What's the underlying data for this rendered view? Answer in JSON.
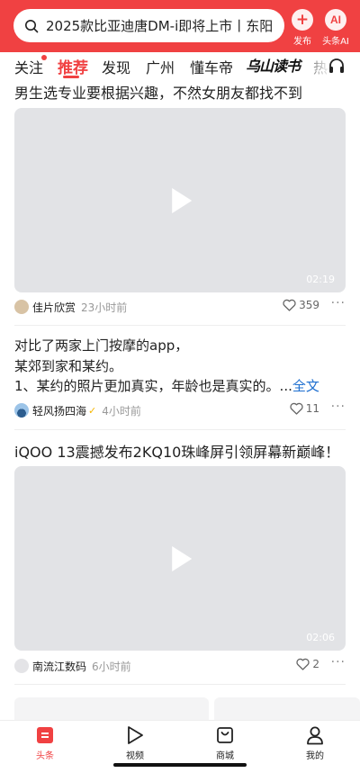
{
  "search": {
    "query": "2025款比亚迪唐DM-i即将上市丨东阳"
  },
  "top_actions": {
    "publish_label": "发布",
    "ai_label": "头条AI",
    "ai_badge": "AI"
  },
  "tabs": [
    {
      "label": "关注"
    },
    {
      "label": "推荐"
    },
    {
      "label": "发现"
    },
    {
      "label": "广州"
    },
    {
      "label": "懂车帝"
    },
    {
      "label": "乌山读书"
    },
    {
      "label": "热"
    }
  ],
  "feed": {
    "item1": {
      "title": "男生选专业要根据兴趣，不然女朋友都找不到",
      "duration": "02:19",
      "source": "佳片欣赏",
      "time": "23小时前",
      "likes": "359"
    },
    "item2": {
      "line1": "对比了两家上门按摩的app，",
      "line2": "某郊到家和某约。",
      "line3": "1、某约的照片更加真实，年龄也是真实的。...",
      "full_text": "全文",
      "source": "轻风扬四海",
      "time": "4小时前",
      "likes": "11"
    },
    "item3": {
      "title": "iQOO 13震撼发布2KQ10珠峰屏引领屏幕新巅峰！",
      "duration": "02:06",
      "source": "南流江数码",
      "time": "6小时前",
      "likes": "2"
    }
  },
  "bottom_nav": [
    {
      "label": "头条"
    },
    {
      "label": "视频"
    },
    {
      "label": "商城"
    },
    {
      "label": "我的"
    }
  ],
  "colors": {
    "brand": "#f04142",
    "link": "#1e6fd0",
    "placeholder": "#e2e3e6"
  }
}
